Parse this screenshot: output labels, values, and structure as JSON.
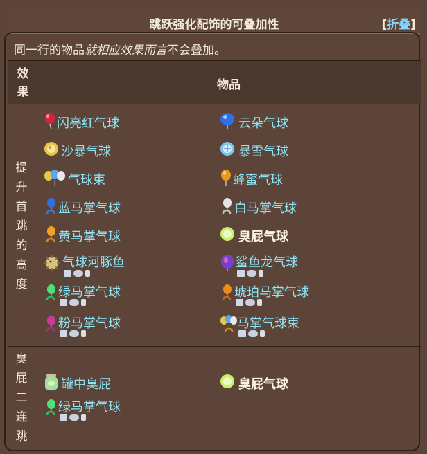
{
  "header": {
    "title": "跳跃强化配饰的可叠加性",
    "toggle_open": "[",
    "toggle_label": "折叠",
    "toggle_close": "]"
  },
  "note": {
    "prefix": "同一行的物品",
    "emphasis": "就相应效果而言",
    "suffix": "不会叠加。"
  },
  "table": {
    "col_effect": "效果",
    "col_items": "物品",
    "groups": [
      {
        "effect": "提升首跳的高度",
        "rows": [
          [
            "闪亮红气球",
            "云朵气球"
          ],
          [
            "沙暴气球",
            "暴雪气球"
          ],
          [
            "气球束",
            "蜂蜜气球"
          ],
          [
            "蓝马掌气球",
            "白马掌气球"
          ],
          [
            "黄马掌气球",
            "臭屁气球"
          ],
          [
            "气球河豚鱼",
            "鲨鱼龙气球"
          ],
          [
            "绿马掌气球",
            "琥珀马掌气球"
          ],
          [
            "粉马掌气球",
            "马掌气球束"
          ]
        ]
      },
      {
        "effect": "臭屁二连跳",
        "rows": [
          [
            "罐中臭屁",
            "臭屁气球"
          ],
          [
            "绿马掌气球",
            ""
          ]
        ]
      }
    ]
  },
  "icons": {
    "red_balloon": "balloon-red-icon",
    "cloud_balloon": "balloon-cloud-icon",
    "sandstorm_balloon": "balloon-sandstorm-icon",
    "blizzard_balloon": "balloon-blizzard-icon",
    "bundle_balloon": "balloon-bundle-icon",
    "honey_balloon": "balloon-honey-icon",
    "fart_balloon": "balloon-fart-icon",
    "fart_jar": "fart-in-jar-icon",
    "platform_pc": "desktop-icon",
    "platform_console": "gamepad-icon",
    "platform_mobile": "mobile-icon"
  },
  "colors": {
    "background": "#5c4538",
    "link": "#8fe3f5",
    "toggle": "#7fd6ff",
    "header_row": "#4a372d"
  }
}
